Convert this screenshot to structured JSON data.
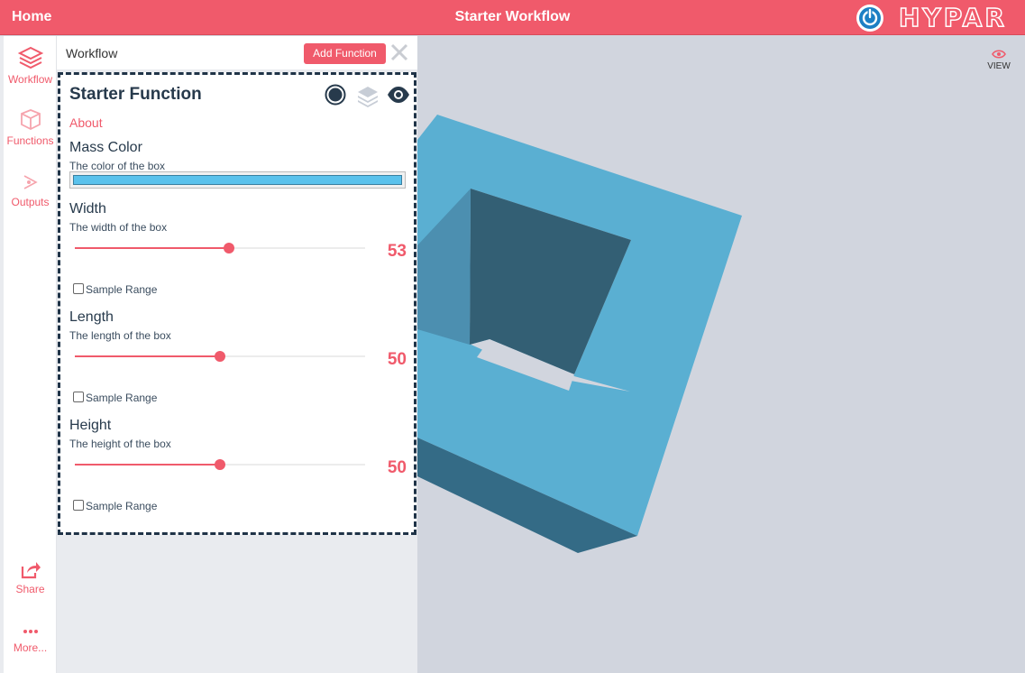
{
  "topbar": {
    "home": "Home",
    "title": "Starter Workflow",
    "brand": "HYPAR"
  },
  "rail": {
    "workflow": "Workflow",
    "functions": "Functions",
    "outputs": "Outputs",
    "share": "Share",
    "more": "More..."
  },
  "panel": {
    "title": "Workflow",
    "add_function": "Add Function",
    "function": {
      "name": "Starter Function",
      "about": "About",
      "mass_color": {
        "name": "Mass Color",
        "description": "The color of the box",
        "value": "#5bc2ec"
      },
      "width": {
        "name": "Width",
        "description": "The width of the box",
        "value": "53",
        "fraction": 0.53
      },
      "length": {
        "name": "Length",
        "description": "The length of the box",
        "value": "50",
        "fraction": 0.5
      },
      "height": {
        "name": "Height",
        "description": "The height of the box",
        "value": "50",
        "fraction": 0.5
      },
      "sample_range": "Sample Range"
    }
  },
  "viewport": {
    "view_label": "VIEW"
  },
  "colors": {
    "accent": "#f05a6b",
    "navy": "#273a4c",
    "mass": "#5bc2ec"
  }
}
